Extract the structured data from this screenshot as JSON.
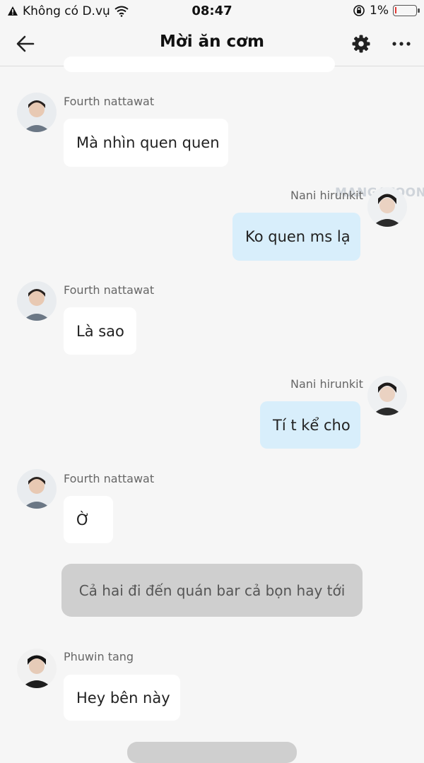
{
  "status_bar": {
    "carrier": "Không có D.vụ",
    "time": "08:47",
    "battery": "1%",
    "icons": [
      "warning-icon",
      "wifi-icon",
      "orientation-lock-icon",
      "battery-icon"
    ]
  },
  "header": {
    "title": "Mời ăn cơm",
    "icons": [
      "back-arrow-icon",
      "gear-icon",
      "more-icon"
    ]
  },
  "watermark": "MANGATOON",
  "messages": [
    {
      "sender": "Fourth nattawat",
      "text": "Mà nhìn quen quen",
      "side": "left"
    },
    {
      "sender": "Nani hirunkit",
      "text": "Ko quen ms lạ",
      "side": "right"
    },
    {
      "sender": "Fourth nattawat",
      "text": "Là sao",
      "side": "left"
    },
    {
      "sender": "Nani hirunkit",
      "text": "Tí t kể cho",
      "side": "right"
    },
    {
      "sender": "Fourth nattawat",
      "text": "Ờ",
      "side": "left"
    },
    {
      "sender": "",
      "text": "Cả hai đi đến quán bar cả bọn hay tới",
      "side": "narration"
    },
    {
      "sender": "Phuwin tang",
      "text": "Hey bên này",
      "side": "left"
    }
  ],
  "colors": {
    "background": "#f6f6f6",
    "incoming_bubble": "#ffffff",
    "outgoing_bubble": "#d8eefb",
    "narration_bubble": "#cfcfcf",
    "battery_low": "#e53935"
  }
}
